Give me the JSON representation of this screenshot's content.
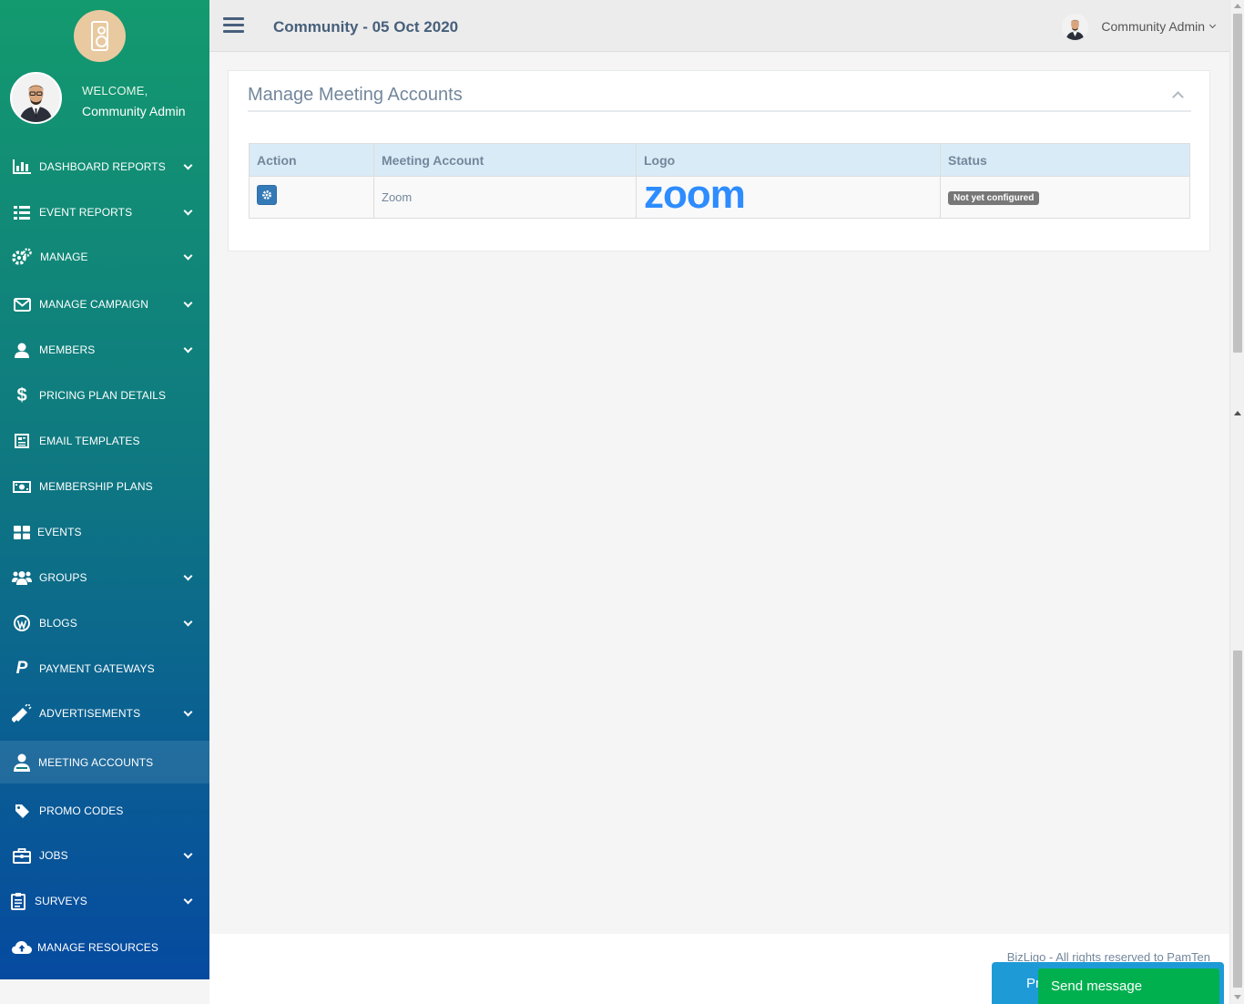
{
  "header": {
    "title": "Community - 05 Oct 2020",
    "user_name": "Community Admin"
  },
  "sidebar": {
    "welcome": "WELCOME,",
    "user_name": "Community Admin",
    "items": [
      {
        "label": "DASHBOARD REPORTS",
        "icon": "bar-chart-icon"
      },
      {
        "label": "EVENT REPORTS",
        "icon": "grid-list-icon"
      },
      {
        "label": "MANAGE",
        "icon": "gears-icon"
      },
      {
        "label": "MANAGE CAMPAIGN",
        "icon": "envelope-icon"
      },
      {
        "label": "MEMBERS",
        "icon": "user-icon"
      },
      {
        "label": "PRICING PLAN DETAILS",
        "icon": "dollar-icon"
      },
      {
        "label": "EMAIL TEMPLATES",
        "icon": "newspaper-icon"
      },
      {
        "label": "MEMBERSHIP PLANS",
        "icon": "money-icon"
      },
      {
        "label": "EVENTS",
        "icon": "th-large-icon"
      },
      {
        "label": "GROUPS",
        "icon": "users-icon"
      },
      {
        "label": "BLOGS",
        "icon": "wordpress-icon"
      },
      {
        "label": "PAYMENT GATEWAYS",
        "icon": "paypal-icon"
      },
      {
        "label": "ADVERTISEMENTS",
        "icon": "bullhorn-icon"
      },
      {
        "label": "MEETING ACCOUNTS",
        "icon": "user-tie-icon"
      },
      {
        "label": "PROMO CODES",
        "icon": "tag-icon"
      },
      {
        "label": "JOBS",
        "icon": "briefcase-icon"
      },
      {
        "label": "SURVEYS",
        "icon": "clipboard-icon"
      },
      {
        "label": "MANAGE RESOURCES",
        "icon": "cloud-upload-icon"
      }
    ]
  },
  "panel": {
    "title": "Manage Meeting Accounts",
    "columns": [
      "Action",
      "Meeting Account",
      "Logo",
      "Status"
    ],
    "rows": [
      {
        "account": "Zoom",
        "logo": "zoom",
        "status": "Not yet configured"
      }
    ]
  },
  "footer": {
    "text": "BizLigo - All rights reserved to PamTen",
    "widget_text": "Pr",
    "send_label": "Send message"
  },
  "colors": {
    "sidebar_top": "#139a6e",
    "sidebar_bottom": "#064aa0",
    "zoom_brand": "#2d8cff",
    "send_button": "#00b04f"
  }
}
